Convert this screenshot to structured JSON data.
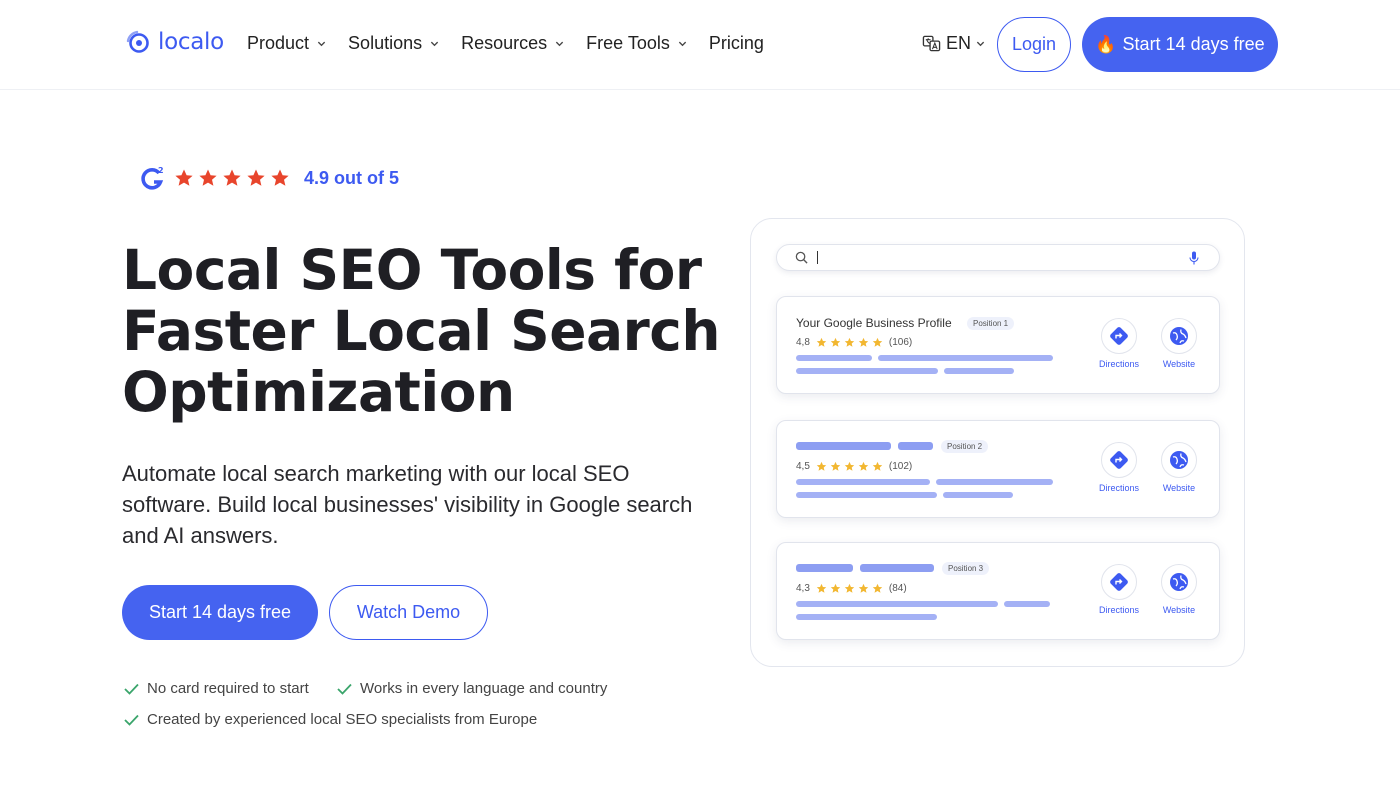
{
  "header": {
    "logo_text": "localo",
    "nav": [
      {
        "label": "Product",
        "has_dropdown": true
      },
      {
        "label": "Solutions",
        "has_dropdown": true
      },
      {
        "label": "Resources",
        "has_dropdown": true
      },
      {
        "label": "Free Tools",
        "has_dropdown": true
      },
      {
        "label": "Pricing",
        "has_dropdown": false
      }
    ],
    "language": "EN",
    "login_label": "Login",
    "start_label": "Start 14 days free",
    "start_icon": "flame-icon"
  },
  "hero": {
    "rating_brand": "G2",
    "rating_stars": 5,
    "rating_text": "4.9 out of 5",
    "title_lines": [
      "Local SEO Tools for",
      "Faster Local Search",
      "Optimization"
    ],
    "subtitle_lines": [
      "Automate local search marketing with our local SEO",
      "software. Build local businesses' visibility in Google search",
      "and AI answers."
    ],
    "cta_primary": "Start 14 days free",
    "cta_secondary": "Watch Demo",
    "features": [
      "No card required to start",
      "Works in every language and country",
      "Created by experienced local SEO specialists from Europe"
    ]
  },
  "mockup": {
    "search_icon": "search-icon",
    "mic_icon": "microphone-icon",
    "results": [
      {
        "title": "Your Google Business Profile",
        "position": "Position 1",
        "rating": "4,8",
        "reviews": "(106)",
        "directions": "Directions",
        "website": "Website"
      },
      {
        "title": "",
        "position": "Position 2",
        "rating": "4,5",
        "reviews": "(102)",
        "directions": "Directions",
        "website": "Website"
      },
      {
        "title": "",
        "position": "Position 3",
        "rating": "4,3",
        "reviews": "(84)",
        "directions": "Directions",
        "website": "Website"
      }
    ]
  },
  "colors": {
    "brand": "#3d5af1",
    "button": "#4563f0",
    "star": "#e8452c",
    "mini_star": "#f2b731",
    "check": "#3aa56b",
    "skeleton": "#a4b1f5"
  }
}
